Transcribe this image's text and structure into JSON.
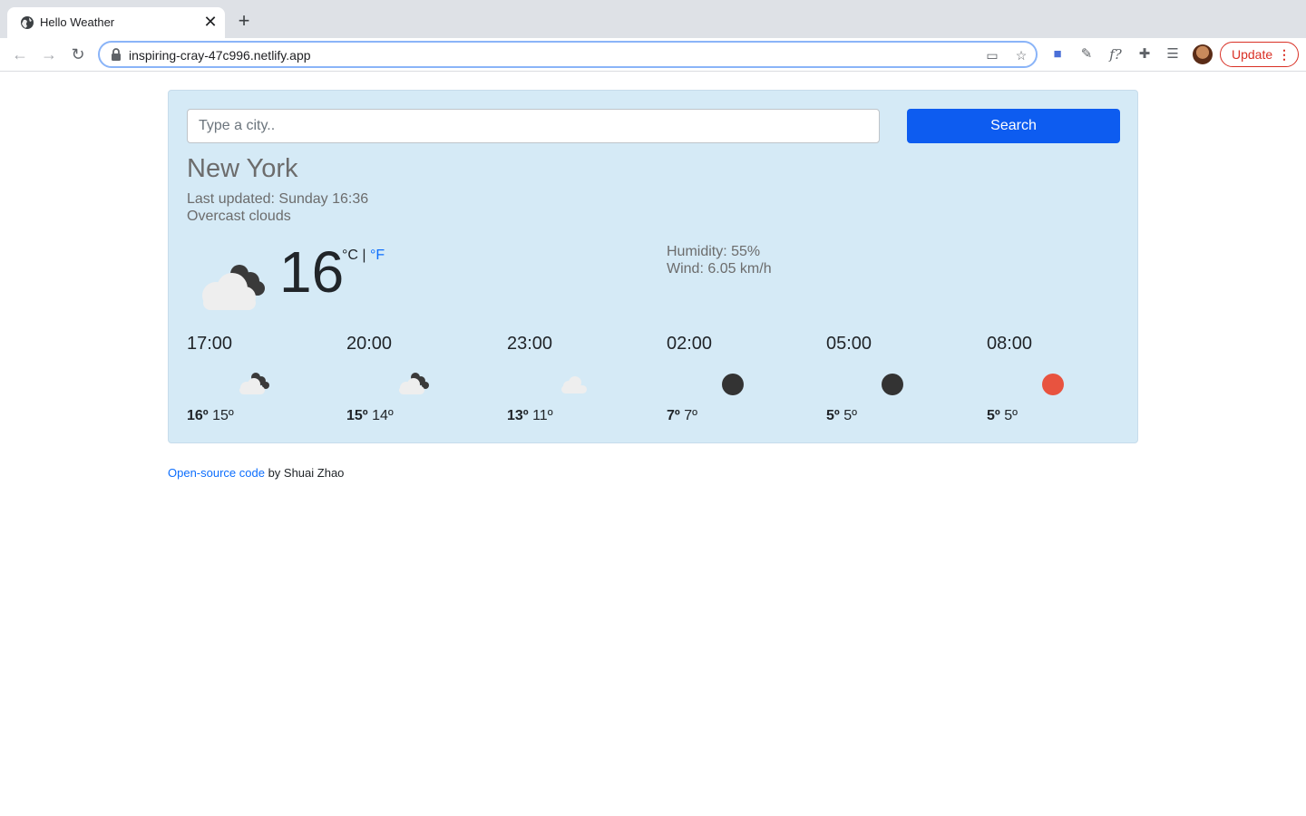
{
  "browser": {
    "tab_title": "Hello Weather",
    "url": "inspiring-cray-47c996.netlify.app",
    "update_label": "Update"
  },
  "search": {
    "placeholder": "Type a city..",
    "button_label": "Search"
  },
  "current": {
    "city": "New York",
    "last_updated": "Last updated: Sunday 16:36",
    "description": "Overcast clouds",
    "temperature": "16",
    "unit_c": "°C",
    "unit_separator": "|",
    "unit_f": "°F",
    "humidity": "Humidity: 55%",
    "wind": "Wind: 6.05 km/h",
    "icon": "broken-clouds-icon"
  },
  "forecast": [
    {
      "time": "17:00",
      "max": "16º",
      "min": "15º",
      "icon": "broken-clouds-icon"
    },
    {
      "time": "20:00",
      "max": "15º",
      "min": "14º",
      "icon": "broken-clouds-icon"
    },
    {
      "time": "23:00",
      "max": "13º",
      "min": "11º",
      "icon": "cloud-icon"
    },
    {
      "time": "02:00",
      "max": "7º",
      "min": "7º",
      "icon": "dark-circle-icon"
    },
    {
      "time": "05:00",
      "max": "5º",
      "min": "5º",
      "icon": "dark-circle-icon"
    },
    {
      "time": "08:00",
      "max": "5º",
      "min": "5º",
      "icon": "sun-icon"
    }
  ],
  "footer": {
    "link_text": "Open-source code",
    "suffix": " by Shuai Zhao"
  },
  "colors": {
    "card_bg": "#d5eaf6",
    "search_button": "#0d5cf0",
    "link": "#0d6efd",
    "sun": "#e8533f",
    "dark_circle": "#333333"
  }
}
